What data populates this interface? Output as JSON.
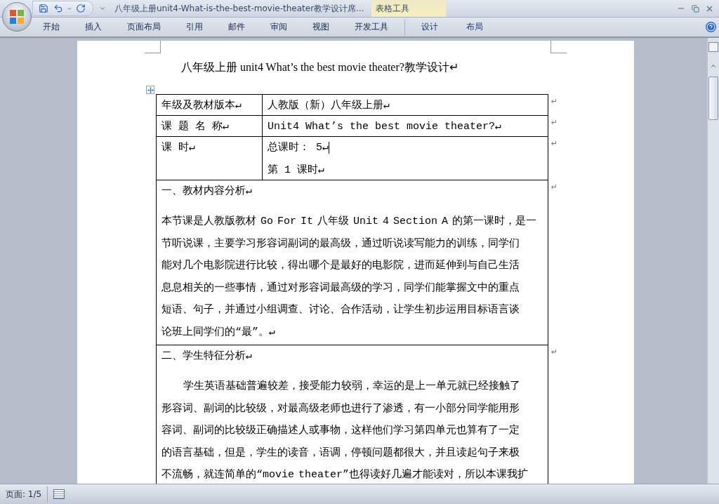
{
  "window": {
    "title": "八年级上册unit4-What-is-the-best-movie-theater教学设计席...",
    "contextual_group": "表格工具"
  },
  "ribbon_tabs": [
    {
      "label": "开始",
      "selected": false
    },
    {
      "label": "插入",
      "selected": false
    },
    {
      "label": "页面布局",
      "selected": false
    },
    {
      "label": "引用",
      "selected": false
    },
    {
      "label": "邮件",
      "selected": false
    },
    {
      "label": "审阅",
      "selected": false
    },
    {
      "label": "视图",
      "selected": false
    },
    {
      "label": "开发工具",
      "selected": false
    },
    {
      "label": "设计",
      "selected": false,
      "contextual": true
    },
    {
      "label": "布局",
      "selected": false,
      "contextual": true
    }
  ],
  "document": {
    "title": "八年级上册 unit4 What’s the best movie theater?教学设计↵",
    "table": {
      "rows": [
        {
          "kind": "pair",
          "label": "年级及教材版本↵",
          "value": [
            "人教版（新）八年级上册↵"
          ],
          "end_mark": "↵"
        },
        {
          "kind": "pair",
          "label": "课 题 名 称↵",
          "value": [
            "Unit4 What’s the best movie theater?↵"
          ],
          "end_mark": "↵"
        },
        {
          "kind": "pair",
          "label": "课 时↵",
          "value": [
            "总课时： 5↵",
            "第 1 课时↵"
          ],
          "end_mark": "↵"
        },
        {
          "kind": "section",
          "heading": "一、教材内容分析↵",
          "first_line_indent": false,
          "lines": [
            "本节课是人教版教材 Go For It 八年级 Unit 4 Section A 的第一课时，是一",
            "节听说课，主要学习形容词副词的最高级，通过听说读写能力的训练，同学们",
            "能对几个电影院进行比较，得出哪个是最好的电影院，进而延伸到与自己生活",
            "息息相关的一些事情，通过对形容词最高级的学习，同学们能掌握文中的重点",
            "短语、句子，并通过小组调查、讨论、合作活动，让学生初步运用目标语言谈",
            "论班上同学们的“最”。↵"
          ],
          "end_mark": "↵"
        },
        {
          "kind": "section",
          "heading": "二、学生特征分析↵",
          "first_line_indent": true,
          "lines": [
            "学生英语基础普遍较差，接受能力较弱，幸运的是上一单元就已经接触了",
            "形容词、副词的比较级，对最高级老师也进行了渗透，有一小部分同学能用形",
            "容词、副词的比较级正确描述人或事物，这样他们学习第四单元也算有了一定",
            "的语言基础，但是，学生的读音，语调，停顿问题都很大，并且读起句子来极",
            "不流畅，就连简单的“movie theater”也得读好几遍才能读对，所以本课我扩"
          ],
          "end_mark": "↵"
        }
      ]
    }
  },
  "status_bar": {
    "page": "页面: 1/5"
  }
}
